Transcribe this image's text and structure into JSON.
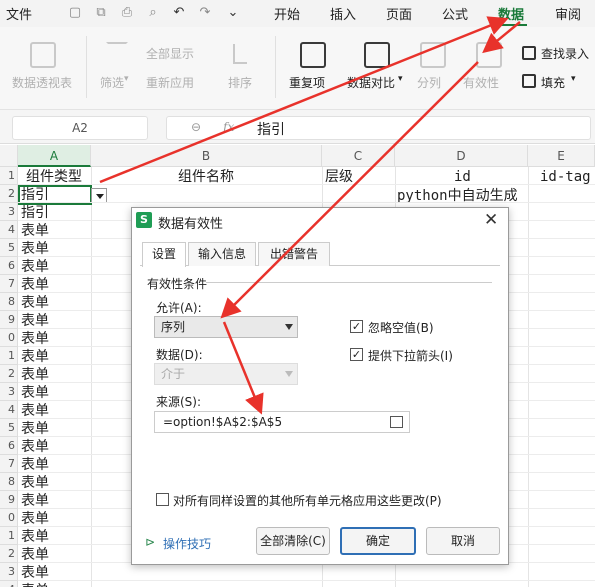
{
  "menubar": {
    "file_label": "文件",
    "tabs": [
      "开始",
      "插入",
      "页面",
      "公式",
      "数据",
      "审阅"
    ],
    "active_tab": "数据"
  },
  "ribbon": {
    "items": [
      {
        "label": "数据透视表",
        "enabled": false
      },
      {
        "label": "筛选",
        "enabled": false
      },
      {
        "label": "全部显示",
        "enabled": false
      },
      {
        "label": "重新应用",
        "enabled": false
      },
      {
        "label": "排序",
        "enabled": false
      },
      {
        "label": "重复项",
        "enabled": true
      },
      {
        "label": "数据对比",
        "enabled": true
      },
      {
        "label": "分列",
        "enabled": false
      },
      {
        "label": "有效性",
        "enabled": false
      },
      {
        "label": "查找录入",
        "enabled": true
      },
      {
        "label": "填充",
        "enabled": true
      }
    ]
  },
  "formula_bar": {
    "name_box": "A2",
    "fx_symbol": "fx",
    "content": "指引"
  },
  "sheet": {
    "columns": [
      "A",
      "B",
      "C",
      "D",
      "E"
    ],
    "selected_column": "A",
    "row_numbers": [
      "1",
      "2",
      "3",
      "4",
      "5",
      "6",
      "7",
      "8",
      "9",
      "0",
      "1",
      "2",
      "3",
      "4",
      "5",
      "6",
      "7",
      "8",
      "9",
      "0",
      "1",
      "2",
      "3",
      "4"
    ],
    "header_row": [
      "组件类型",
      "组件名称",
      "层级",
      "id",
      "id-tag"
    ],
    "d2": "python中自动生成",
    "col_a_values": [
      "指引",
      "指引",
      "表单",
      "表单",
      "表单",
      "表单",
      "表单",
      "表单",
      "表单",
      "表单",
      "表单",
      "表单",
      "表单",
      "表单",
      "表单",
      "表单",
      "表单",
      "表单",
      "表单",
      "表单",
      "表单",
      "表单",
      "表单"
    ]
  },
  "dialog": {
    "title": "数据有效性",
    "tabs": [
      "设置",
      "输入信息",
      "出错警告"
    ],
    "section": "有效性条件",
    "allow_label": "允许(A):",
    "allow_value": "序列",
    "data_label": "数据(D):",
    "data_value": "介于",
    "ignore_blank": "忽略空值(B)",
    "show_dropdown": "提供下拉箭头(I)",
    "source_label": "来源(S):",
    "source_value": "=option!$A$2:$A$5",
    "apply_all": "对所有同样设置的其他所有单元格应用这些更改(P)",
    "tips_link": "操作技巧",
    "clear_button": "全部清除(C)",
    "ok_button": "确定",
    "cancel_button": "取消"
  },
  "colors": {
    "accent_green": "#1a7a3a",
    "annotation_red": "#e8322b",
    "dialog_primary_border": "#2f6fb5"
  }
}
